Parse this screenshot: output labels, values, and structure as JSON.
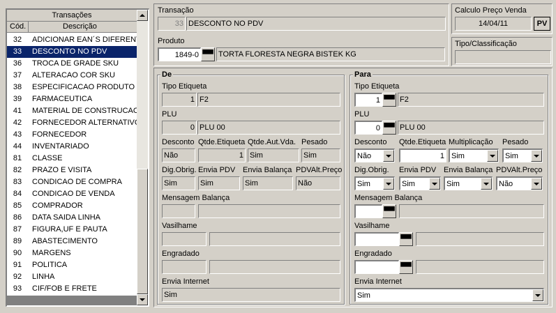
{
  "list": {
    "header": "Transações",
    "col_cod": "Cód.",
    "col_desc": "Descrição",
    "selected_index": 1,
    "rows": [
      {
        "cod": "32",
        "desc": "ADICIONAR EAN´S DIFERENTE"
      },
      {
        "cod": "33",
        "desc": "DESCONTO NO PDV"
      },
      {
        "cod": "36",
        "desc": "TROCA DE GRADE SKU"
      },
      {
        "cod": "37",
        "desc": "ALTERACAO COR SKU"
      },
      {
        "cod": "38",
        "desc": "ESPECIFICACAO PRODUTO"
      },
      {
        "cod": "39",
        "desc": "FARMACEUTICA"
      },
      {
        "cod": "41",
        "desc": "MATERIAL DE CONSTRUCAO"
      },
      {
        "cod": "42",
        "desc": "FORNECEDOR ALTERNATIVO"
      },
      {
        "cod": "43",
        "desc": "FORNECEDOR"
      },
      {
        "cod": "44",
        "desc": "INVENTARIADO"
      },
      {
        "cod": "81",
        "desc": "CLASSE"
      },
      {
        "cod": "82",
        "desc": "PRAZO E VISITA"
      },
      {
        "cod": "83",
        "desc": "CONDICAO DE COMPRA"
      },
      {
        "cod": "84",
        "desc": "CONDICAO DE VENDA"
      },
      {
        "cod": "85",
        "desc": "COMPRADOR"
      },
      {
        "cod": "86",
        "desc": "DATA SAIDA LINHA"
      },
      {
        "cod": "87",
        "desc": "FIGURA,UF E PAUTA"
      },
      {
        "cod": "89",
        "desc": "ABASTECIMENTO"
      },
      {
        "cod": "90",
        "desc": "MARGENS"
      },
      {
        "cod": "91",
        "desc": "POLITICA"
      },
      {
        "cod": "92",
        "desc": "LINHA"
      },
      {
        "cod": "93",
        "desc": "CIF/FOB E FRETE"
      }
    ]
  },
  "transacao": {
    "label": "Transação",
    "code": "33",
    "desc": "DESCONTO NO PDV"
  },
  "produto": {
    "label": "Produto",
    "code": "1849-0",
    "desc": "TORTA FLORESTA NEGRA BISTEK KG"
  },
  "calculo": {
    "label": "Calculo Preço Venda",
    "date": "14/04/11",
    "btn": "PV"
  },
  "tipo_class": {
    "label": "Tipo/Classificação",
    "value": ""
  },
  "de": {
    "title": "De",
    "tipo_etiqueta_label": "Tipo Etiqueta",
    "tipo_etiqueta_num": "1",
    "tipo_etiqueta_desc": "F2",
    "plu_label": "PLU",
    "plu_num": "0",
    "plu_desc": "PLU 00",
    "desconto_label": "Desconto",
    "desconto": "Não",
    "qtde_etiqueta_label": "Qtde.Etiqueta",
    "qtde_etiqueta": "1",
    "qtde_aut_label": "Qtde.Aut.Vda.",
    "qtde_aut": "Sim",
    "pesado_label": "Pesado",
    "pesado": "Sim",
    "dig_obrig_label": "Dig.Obrig.",
    "dig_obrig": "Sim",
    "envia_pdv_label": "Envia PDV",
    "envia_pdv": "Sim",
    "envia_balanca_label": "Envia Balança",
    "envia_balanca": "Sim",
    "pdv_alt_label": "PDVAlt.Preço",
    "pdv_alt": "Não",
    "mensagem_label": "Mensagem Balança",
    "vasilhame_label": "Vasilhame",
    "engradado_label": "Engradado",
    "envia_internet_label": "Envia Internet",
    "envia_internet": "Sim"
  },
  "para": {
    "title": "Para",
    "tipo_etiqueta_label": "Tipo Etiqueta",
    "tipo_etiqueta_num": "1",
    "tipo_etiqueta_desc": "F2",
    "plu_label": "PLU",
    "plu_num": "0",
    "plu_desc": "PLU 00",
    "desconto_label": "Desconto",
    "desconto": "Não",
    "qtde_etiqueta_label": "Qtde.Etiqueta",
    "qtde_etiqueta": "1",
    "mult_label": "Multiplicação",
    "mult": "Sim",
    "pesado_label": "Pesado",
    "pesado": "Sim",
    "dig_obrig_label": "Dig.Obrig.",
    "dig_obrig": "Sim",
    "envia_pdv_label": "Envia PDV",
    "envia_pdv": "Sim",
    "envia_balanca_label": "Envia Balança",
    "envia_balanca": "Sim",
    "pdv_alt_label": "PDVAlt.Preço",
    "pdv_alt": "Não",
    "mensagem_label": "Mensagem Balança",
    "vasilhame_label": "Vasilhame",
    "engradado_label": "Engradado",
    "envia_internet_label": "Envia Internet",
    "envia_internet": "Sim"
  }
}
